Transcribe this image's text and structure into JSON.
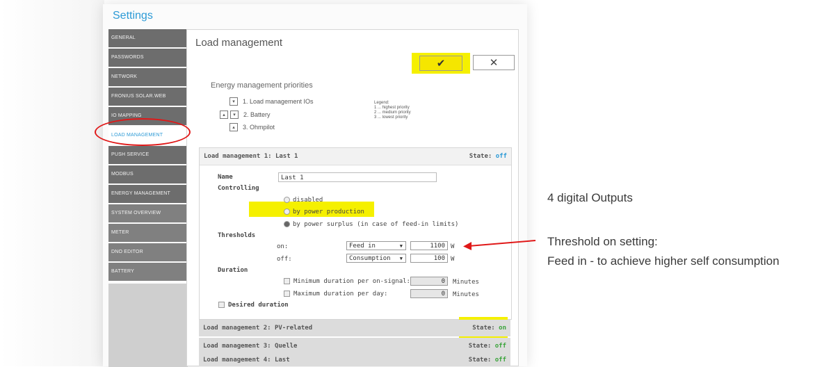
{
  "settings_title": "Settings",
  "sidebar": {
    "items": [
      {
        "label": "GENERAL"
      },
      {
        "label": "PASSWORDS"
      },
      {
        "label": "NETWORK"
      },
      {
        "label": "FRONIUS SOLAR.WEB"
      },
      {
        "label": "IO MAPPING"
      },
      {
        "label": "LOAD MANAGEMENT"
      },
      {
        "label": "PUSH SERVICE"
      },
      {
        "label": "MODBUS"
      },
      {
        "label": "ENERGY MANAGEMENT"
      },
      {
        "label": "SYSTEM OVERVIEW"
      },
      {
        "label": "METER"
      },
      {
        "label": "DNO EDITOR"
      },
      {
        "label": "BATTERY"
      }
    ]
  },
  "panel": {
    "title": "Load management",
    "ok_symbol": "✔",
    "cancel_symbol": "✕"
  },
  "priorities": {
    "title": "Energy management priorities",
    "items": [
      "1. Load management IOs",
      "2. Battery",
      "3. Ohmpilot"
    ],
    "legend": [
      "Legend:",
      "1 ... highest priority",
      "2 ... medium priority",
      "3 ... lowest priority"
    ]
  },
  "lm1": {
    "header": "Load management 1: Last 1",
    "state_label": "State:",
    "state_value": "off",
    "name_label": "Name",
    "name_value": "Last 1",
    "controlling_label": "Controlling",
    "options": [
      "disabled",
      "by power production",
      "by power surplus (in case of feed-in limits)"
    ],
    "thresholds_label": "Thresholds",
    "on_label": "on:",
    "off_label": "off:",
    "on_select": "Feed in",
    "off_select": "Consumption",
    "on_value": "1100",
    "off_value": "100",
    "unit": "W",
    "duration_label": "Duration",
    "min_label": "Minimum duration per on-signal:",
    "max_label": "Maximum duration per day:",
    "min_value": "0",
    "max_value": "0",
    "minutes": "Minutes",
    "desired_label": "Desired duration"
  },
  "lm_other": [
    {
      "header": "Load management 2: PV-related",
      "state_label": "State:",
      "state_value": "on"
    },
    {
      "header": "Load management 3: Quelle",
      "state_label": "State:",
      "state_value": "off"
    },
    {
      "header": "Load management 4: Last",
      "state_label": "State:",
      "state_value": "off"
    }
  ],
  "notes": {
    "outputs": "4 digital Outputs",
    "threshold_line1": "Threshold on setting:",
    "threshold_line2": "Feed in - to achieve higher self consumption"
  },
  "colors": {
    "accent": "#2c9ad6",
    "highlight": "#f5f000",
    "annotation_red": "#e01818"
  }
}
